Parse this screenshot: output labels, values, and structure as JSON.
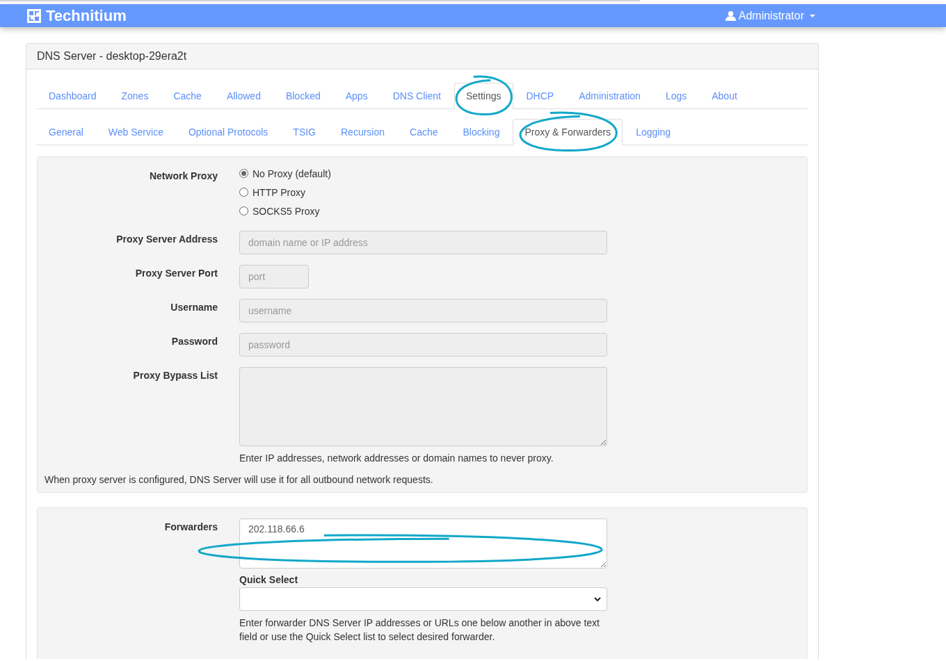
{
  "navbar": {
    "brand": "Technitium",
    "user": "Administrator"
  },
  "panel": {
    "title": "DNS Server - desktop-29era2t"
  },
  "tabs": [
    {
      "label": "Dashboard",
      "selected": false
    },
    {
      "label": "Zones",
      "selected": false
    },
    {
      "label": "Cache",
      "selected": false
    },
    {
      "label": "Allowed",
      "selected": false
    },
    {
      "label": "Blocked",
      "selected": false
    },
    {
      "label": "Apps",
      "selected": false
    },
    {
      "label": "DNS Client",
      "selected": false
    },
    {
      "label": "Settings",
      "selected": true
    },
    {
      "label": "DHCP",
      "selected": false
    },
    {
      "label": "Administration",
      "selected": false
    },
    {
      "label": "Logs",
      "selected": false
    },
    {
      "label": "About",
      "selected": false
    }
  ],
  "subtabs": [
    {
      "label": "General",
      "selected": false
    },
    {
      "label": "Web Service",
      "selected": false
    },
    {
      "label": "Optional Protocols",
      "selected": false
    },
    {
      "label": "TSIG",
      "selected": false
    },
    {
      "label": "Recursion",
      "selected": false
    },
    {
      "label": "Cache",
      "selected": false
    },
    {
      "label": "Blocking",
      "selected": false
    },
    {
      "label": "Proxy & Forwarders",
      "selected": true
    },
    {
      "label": "Logging",
      "selected": false
    }
  ],
  "proxy_section": {
    "rows": [
      {
        "kind": "radios",
        "label": "Network Proxy",
        "options": [
          {
            "label": "No Proxy (default)",
            "selected": true
          },
          {
            "label": "HTTP Proxy",
            "selected": false
          },
          {
            "label": "SOCKS5 Proxy",
            "selected": false
          }
        ]
      },
      {
        "kind": "input",
        "label": "Proxy Server Address",
        "placeholder": "domain name or IP address",
        "disabled": true
      },
      {
        "kind": "short-input",
        "label": "Proxy Server Port",
        "placeholder": "port",
        "disabled": true
      },
      {
        "kind": "input",
        "label": "Username",
        "placeholder": "username",
        "disabled": true
      },
      {
        "kind": "input",
        "label": "Password",
        "placeholder": "password",
        "disabled": true
      },
      {
        "kind": "textarea",
        "label": "Proxy Bypass List",
        "disabled": true,
        "help": "Enter IP addresses, network addresses or domain names to never proxy."
      }
    ],
    "note": "When proxy server is configured, DNS Server will use it for all outbound network requests."
  },
  "forwarders_section": {
    "label": "Forwarders",
    "value": "202.118.66.6",
    "quick_select_label": "Quick Select",
    "help": "Enter forwarder DNS Server IP addresses or URLs one below another in above text field or use the Quick Select list to select desired forwarder."
  }
}
